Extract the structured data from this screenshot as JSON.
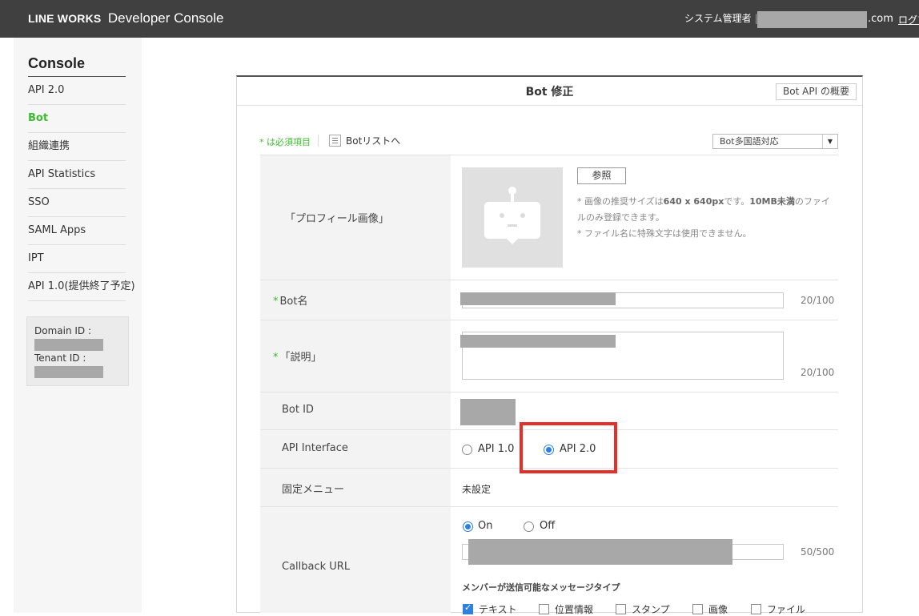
{
  "header": {
    "brand": "LINE WORKS",
    "app_name": "Developer Console",
    "role": "システム管理者",
    "separator": "|",
    "email_suffix": ".com",
    "logout": "ログア"
  },
  "sidebar": {
    "title": "Console",
    "items": [
      {
        "label": "API 2.0",
        "active": false
      },
      {
        "label": "Bot",
        "active": true
      },
      {
        "label": "組織連携",
        "active": false
      },
      {
        "label": "API Statistics",
        "active": false
      },
      {
        "label": "SSO",
        "active": false
      },
      {
        "label": "SAML Apps",
        "active": false
      },
      {
        "label": "IPT",
        "active": false
      },
      {
        "label": "API 1.0(提供終了予定)",
        "active": false
      }
    ],
    "domain_label": "Domain ID :",
    "tenant_label": "Tenant ID :"
  },
  "panel": {
    "title": "Bot 修正",
    "api_overview_button": "Bot API の概要",
    "required_note": "* は必須項目",
    "bot_list_link": "Botリストへ",
    "language_select": "Bot多国語対応"
  },
  "form": {
    "profile_label": "「プロフィール画像」",
    "browse_button": "参照",
    "hint1_pre": "* 画像の推奨サイズは",
    "hint1_bold": "640 x 640px",
    "hint1_mid": "です。",
    "hint1_bold2": "10MB未満",
    "hint1_post": "のファイ",
    "hint2": "ルのみ登録できます。",
    "hint3": "* ファイル名に特殊文字は使用できません。",
    "required_star": "*",
    "bot_name_label": "Bot名",
    "bot_name_counter": "20/100",
    "description_label": "「説明」",
    "description_counter": "20/100",
    "bot_id_label": "Bot ID",
    "api_interface_label": "API Interface",
    "api_options": [
      {
        "label": "API 1.0",
        "selected": false
      },
      {
        "label": "API 2.0",
        "selected": true
      }
    ],
    "fixed_menu_label": "固定メニュー",
    "fixed_menu_value": "未設定",
    "callback_label": "Callback URL",
    "callback_options": [
      {
        "label": "On",
        "selected": true
      },
      {
        "label": "Off",
        "selected": false
      }
    ],
    "callback_counter": "50/500",
    "message_type_label": "メンバーが送信可能なメッセージタイプ",
    "message_types": [
      {
        "label": "テキスト",
        "checked": true
      },
      {
        "label": "位置情報",
        "checked": false
      },
      {
        "label": "スタンプ",
        "checked": false
      },
      {
        "label": "画像",
        "checked": false
      },
      {
        "label": "ファイル",
        "checked": false
      }
    ]
  },
  "colors": {
    "accent_green": "#3dbb2f",
    "radio_blue": "#2d7fe0",
    "highlight_red": "#e3312a",
    "topbar": "#404040"
  }
}
